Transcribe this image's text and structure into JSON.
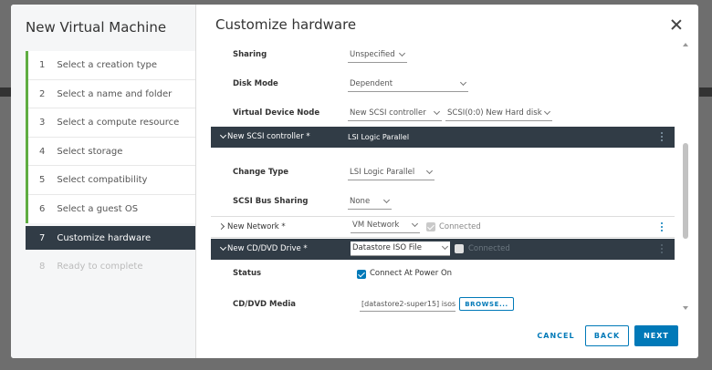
{
  "wizard": {
    "title": "New Virtual Machine",
    "steps": [
      {
        "num": "1",
        "label": "Select a creation type",
        "state": "done"
      },
      {
        "num": "2",
        "label": "Select a name and folder",
        "state": "done"
      },
      {
        "num": "3",
        "label": "Select a compute resource",
        "state": "done"
      },
      {
        "num": "4",
        "label": "Select storage",
        "state": "done"
      },
      {
        "num": "5",
        "label": "Select compatibility",
        "state": "done"
      },
      {
        "num": "6",
        "label": "Select a guest OS",
        "state": "done"
      },
      {
        "num": "7",
        "label": "Customize hardware",
        "state": "active"
      },
      {
        "num": "8",
        "label": "Ready to complete",
        "state": "disabled"
      }
    ]
  },
  "panel": {
    "title": "Customize hardware",
    "close_icon": "close-icon"
  },
  "hardware": {
    "sharing": {
      "label": "Sharing",
      "value": "Unspecified"
    },
    "disk_mode": {
      "label": "Disk Mode",
      "value": "Dependent"
    },
    "virtual_device_node": {
      "label": "Virtual Device Node",
      "controller": "New SCSI controller",
      "disk": "SCSI(0:0) New Hard disk"
    },
    "scsi_controller": {
      "title": "New SCSI controller *",
      "value": "LSI Logic Parallel"
    },
    "change_type": {
      "label": "Change Type",
      "value": "LSI Logic Parallel"
    },
    "scsi_bus_sharing": {
      "label": "SCSI Bus Sharing",
      "value": "None"
    },
    "new_network": {
      "title": "New Network *",
      "value": "VM Network",
      "connected_label": "Connected"
    },
    "cd_dvd": {
      "title": "New CD/DVD Drive *",
      "value": "Datastore ISO File",
      "connected_label": "Connected"
    },
    "status": {
      "label": "Status",
      "checkbox_label": "Connect At Power On"
    },
    "cd_dvd_media": {
      "label": "CD/DVD Media",
      "value": "[datastore2-super15] isos/",
      "browse_label": "BROWSE..."
    }
  },
  "footer": {
    "cancel": "CANCEL",
    "back": "BACK",
    "next": "NEXT"
  },
  "colors": {
    "accent": "#0079b8",
    "dark_band": "#313c46",
    "done_marker": "#5fad41"
  }
}
